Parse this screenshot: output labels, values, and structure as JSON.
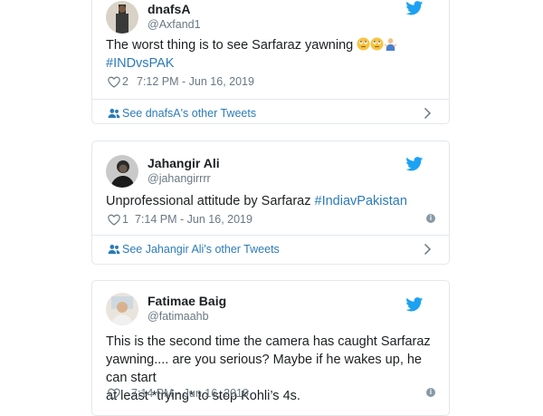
{
  "tweets": [
    {
      "name": "dnafsA",
      "handle": "@Axfand1",
      "text": "The worst thing is to see Sarfaraz yawning ",
      "hashtag": "#INDvsPAK",
      "emoji_icons": [
        "face-with-rolling-eyes-icon",
        "face-with-rolling-eyes-icon",
        "person-shrugging-icon"
      ],
      "likes": "2",
      "timestamp": "7:12 PM - Jun 16, 2019",
      "footer_link": "See dnafsA's other Tweets"
    },
    {
      "name": "Jahangir Ali",
      "handle": "@jahangirrrr",
      "text": "Unprofessional attitude by Sarfaraz ",
      "hashtag": "#IndiavPakistan",
      "likes": "1",
      "timestamp": "7:14 PM - Jun 16, 2019",
      "footer_link": "See Jahangir Ali's other Tweets"
    },
    {
      "name": "Fatimae Baig",
      "handle": "@fatimaahb",
      "text_lines": [
        "This is the second time the camera has caught Sarfaraz",
        "yawning.... are you serious? Maybe if he wakes up, he can start",
        "at least *trying* to stop Kohli’s 4s."
      ],
      "timestamp": "7:14 PM - Jun 16, 2019"
    }
  ],
  "colors": {
    "link": "#2b7bb9",
    "muted": "#697882",
    "border": "#e1e8ed",
    "twitter": "#1da1f2"
  }
}
